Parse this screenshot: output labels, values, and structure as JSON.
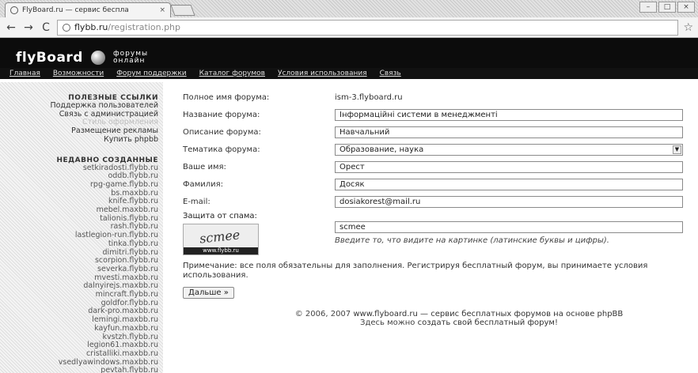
{
  "browser": {
    "tab_title": "FlyBoard.ru — сервис беспла",
    "tab_close": "×",
    "url_host": "flybb.ru",
    "url_path": "/registration.php",
    "back": "←",
    "forward": "→",
    "reload": "C",
    "star": "☆",
    "win_min": "–",
    "win_max": "□",
    "win_close": "×"
  },
  "site": {
    "logo": "flyBoard",
    "tagline_1": "форумы",
    "tagline_2": "онлайн",
    "nav": [
      "Главная",
      "Возможности",
      "Форум поддержки",
      "Каталог форумов",
      "Условия использования",
      "Связь"
    ]
  },
  "sidebar": {
    "links_title": "ПОЛЕЗНЫЕ ССЫЛКИ",
    "links": [
      "Поддержка пользователей",
      "Связь с администрацией",
      "Стиль оформления",
      "Размещение рекламы",
      "Купить phpbb"
    ],
    "recent_title": "НЕДАВНО СОЗДАННЫЕ",
    "recent": [
      "setkiradosti.flybb.ru",
      "oddb.flybb.ru",
      "rpg-game.flybb.ru",
      "bs.maxbb.ru",
      "knife.flybb.ru",
      "mebel.maxbb.ru",
      "talionis.flybb.ru",
      "rash.flybb.ru",
      "lastlegion-run.flybb.ru",
      "tinka.flybb.ru",
      "dimitri.flybb.ru",
      "scorpion.flybb.ru",
      "severka.flybb.ru",
      "mvesti.maxbb.ru",
      "dalnyirejs.maxbb.ru",
      "mincraft.flybb.ru",
      "goldfor.flybb.ru",
      "dark-pro.maxbb.ru",
      "lemingi.maxbb.ru",
      "kayfun.maxbb.ru",
      "kvstzh.flybb.ru",
      "legion61.maxbb.ru",
      "cristalliki.maxbb.ru",
      "vsedlyawindows.maxbb.ru",
      "pevtah.flybb.ru"
    ]
  },
  "form": {
    "full_name_label": "Полное имя форума:",
    "full_name_value": "ism-3.flyboard.ru",
    "forum_name_label": "Название форума:",
    "forum_name_value": "Інформаційні системи в менеджменті",
    "desc_label": "Описание форума:",
    "desc_value": "Навчальний",
    "topic_label": "Тематика форума:",
    "topic_value": "Образование, наука",
    "name_label": "Ваше имя:",
    "name_value": "Орест",
    "surname_label": "Фамилия:",
    "surname_value": "Досяк",
    "email_label": "E-mail:",
    "email_value": "dosiakorest@mail.ru",
    "spam_label": "Защита от спама:",
    "captcha_word": "scmee",
    "captcha_strip": "www.flybb.ru",
    "captcha_value": "scmee",
    "captcha_hint": "Введите то, что видите на картинке (латинские буквы и цифры).",
    "note_text": "Примечание: все поля обязательны для заполнения. Регистрируя бесплатный форум, вы принимаете ",
    "note_link": "условия использования",
    "note_end": ".",
    "submit_label": "Дальше »"
  },
  "footer": {
    "copyright": "© 2006, 2007",
    "link": "www.flyboard.ru — сервис бесплатных форумов на основе phpBB",
    "line2_pre": "Здесь можно ",
    "line2_link": "создать свой бесплатный форум",
    "line2_post": "!"
  }
}
